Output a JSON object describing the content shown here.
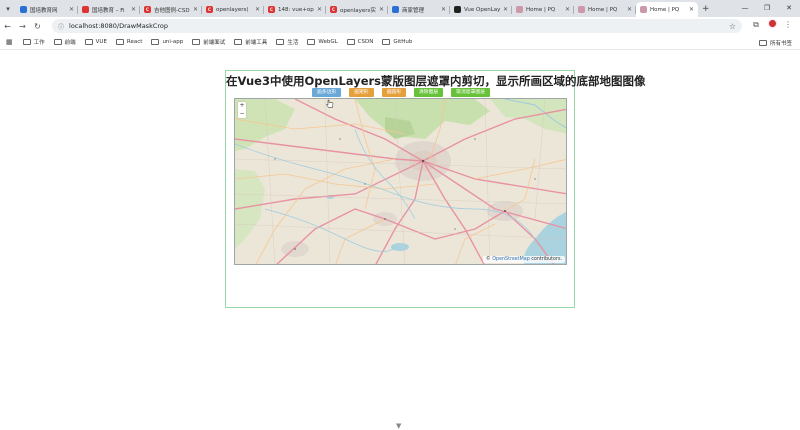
{
  "browser": {
    "tabs": [
      {
        "title": "国培教育网",
        "color": "#2a6fd6",
        "glyph": ""
      },
      {
        "title": "国培教育 – Fi",
        "color": "#d33",
        "glyph": ""
      },
      {
        "title": "吉他图例-CSD",
        "color": "#d33",
        "glyph": "C"
      },
      {
        "title": "openlayers(",
        "color": "#d33",
        "glyph": "C"
      },
      {
        "title": "148: vue+op",
        "color": "#d33",
        "glyph": "C"
      },
      {
        "title": "openlayers实",
        "color": "#d33",
        "glyph": "C"
      },
      {
        "title": "商家管理",
        "color": "#2a6fd6",
        "glyph": ""
      },
      {
        "title": "Vue OpenLay",
        "color": "#222",
        "glyph": ""
      },
      {
        "title": "Home | PQ",
        "color": "#c9a",
        "glyph": ""
      },
      {
        "title": "Home | PQ",
        "color": "#c9a",
        "glyph": ""
      },
      {
        "title": "Home | PQ",
        "color": "#c9a",
        "glyph": "",
        "active": true
      }
    ],
    "url": "localhost:8080/DrawMaskCrop",
    "bookmarks": [
      "工作",
      "前端",
      "VUE",
      "React",
      "uni-app",
      "前端面试",
      "前端工具",
      "生活",
      "WebGL",
      "CSDN",
      "GitHub"
    ],
    "all_bookmarks_label": "所有书签"
  },
  "page": {
    "title": "在Vue3中使用OpenLayers蒙版图层遮罩内剪切，显示所画区域的底部地图图像",
    "buttons": [
      {
        "label": "画多边形",
        "color": "blue"
      },
      {
        "label": "画矩形",
        "color": "orange"
      },
      {
        "label": "画圆形",
        "color": "orange"
      },
      {
        "label": "清除图层",
        "color": "green"
      },
      {
        "label": "取消遮罩图层",
        "color": "green"
      }
    ],
    "map": {
      "zoom_in": "+",
      "zoom_out": "−",
      "attribution_prefix": "©",
      "attribution_link": "OpenStreetMap",
      "attribution_suffix": "contributors."
    }
  }
}
